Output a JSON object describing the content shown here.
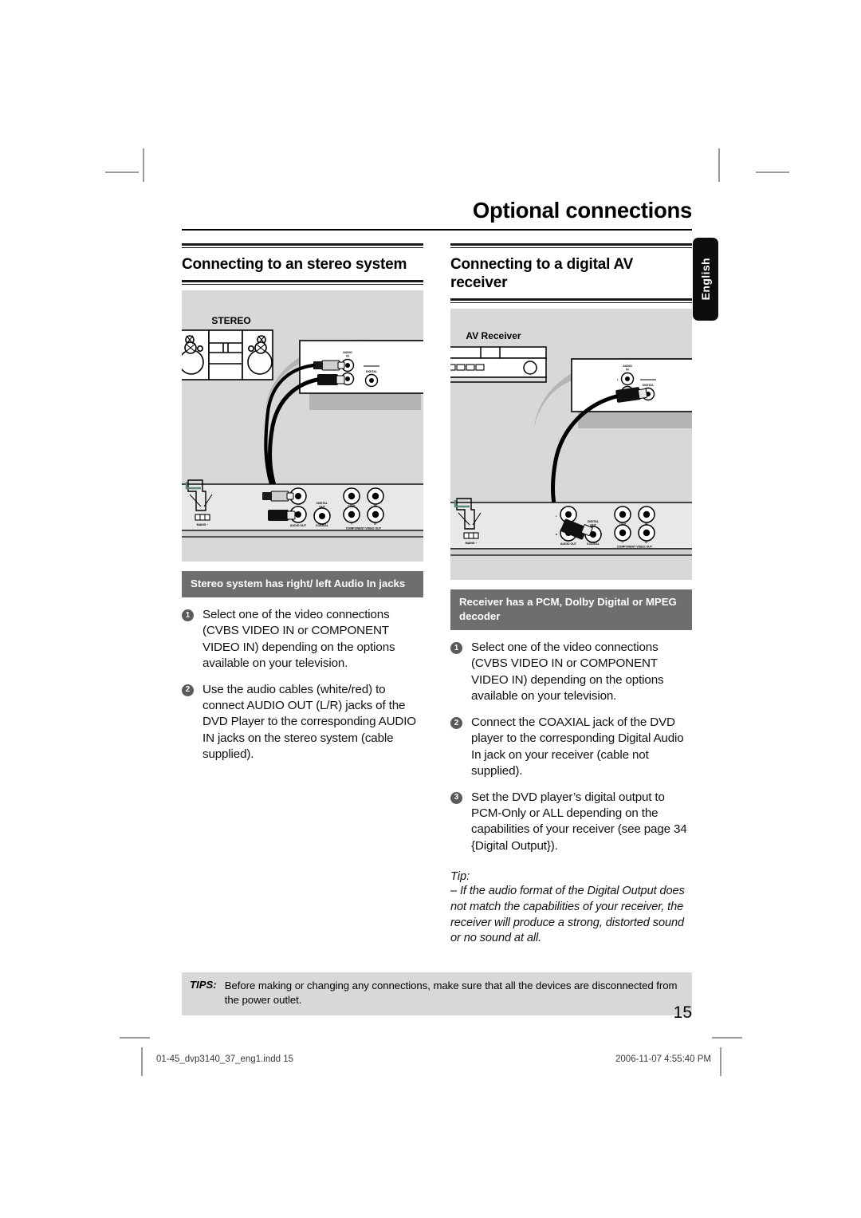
{
  "header": {
    "doc_title": "Optional connections",
    "language_tab": "English"
  },
  "columns": [
    {
      "id": "stereo",
      "section_title": "Connecting to an stereo system",
      "illustration": {
        "device_label": "STEREO",
        "tv_jack_labels": [
          "AUDIO",
          "IN",
          "L",
          "R",
          "DIGITAL"
        ],
        "dvd_panel_labels": [
          "MAINS ~",
          "AUDIO OUT",
          "COAXIAL",
          "DIGITAL OUT",
          "COMPONENT VIDEO OUT",
          "Y",
          "Pb",
          "Pr",
          "L",
          "R"
        ]
      },
      "subhead": "Stereo system has right/ left Audio In jacks",
      "steps": [
        {
          "num": "1",
          "text": "Select one of the video connections (CVBS VIDEO IN or COMPONENT VIDEO IN) depending on the options available on your television."
        },
        {
          "num": "2",
          "text": "Use the audio cables (white/red) to connect AUDIO OUT (L/R) jacks of the DVD Player to the corresponding AUDIO IN jacks on the stereo system (cable supplied)."
        }
      ],
      "tip": null
    },
    {
      "id": "av-receiver",
      "section_title": "Connecting to a digital AV receiver",
      "illustration": {
        "device_label": "AV Receiver",
        "tv_jack_labels": [
          "AUDIO",
          "IN",
          "L",
          "R",
          "DIGITAL"
        ],
        "dvd_panel_labels": [
          "MAINS ~",
          "AUDIO OUT",
          "COAXIAL",
          "DIGITAL OUT",
          "COMPONENT VIDEO OUT",
          "Y",
          "Pb",
          "Pr",
          "L",
          "R"
        ]
      },
      "subhead": "Receiver has a PCM, Dolby Digital or MPEG decoder",
      "steps": [
        {
          "num": "1",
          "text": "Select one of the video connections (CVBS VIDEO IN or COMPONENT VIDEO IN) depending on the options available on your television."
        },
        {
          "num": "2",
          "text": "Connect the COAXIAL jack of the DVD player to the corresponding Digital Audio In jack on your receiver (cable not supplied)."
        },
        {
          "num": "3",
          "text": "Set the DVD player’s digital output to PCM-Only or ALL depending on the capabilities of your receiver (see page 34 {Digital Output})."
        }
      ],
      "tip": {
        "label": "Tip:",
        "text": "– If the audio format of the Digital Output does not match the capabilities of your receiver, the receiver will produce a strong, distorted sound or no sound at all."
      }
    }
  ],
  "tips_bar": {
    "key": "TIPS:",
    "value": "Before making or changing any connections, make sure that all the devices are disconnected from the power outlet."
  },
  "page_number": "15",
  "footer": {
    "file": "01-45_dvp3140_37_eng1.indd   15",
    "date": "2006-11-07   4:55:40 PM"
  },
  "colors": {
    "panel_bg": "#d8d8d8",
    "subhead_bg": "#6e6e6e",
    "rule": "#1a1a1a",
    "tab_bg": "#0d0d0d"
  }
}
